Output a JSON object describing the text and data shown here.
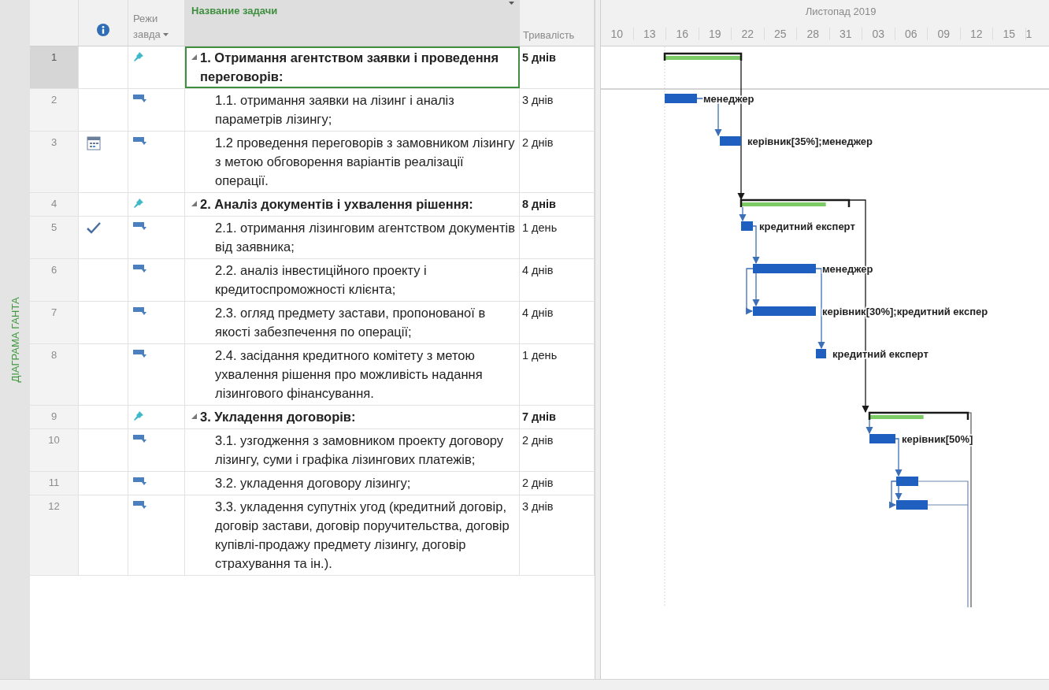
{
  "view_bar": {
    "label": "ДІАГРАМА ГАНТА"
  },
  "table": {
    "columns": {
      "mode": [
        "Режи",
        "завда"
      ],
      "name": "Название задачи",
      "duration": "Тривалість"
    },
    "rows": [
      {
        "id": "1",
        "kind": "summary",
        "calendar": false,
        "complete": false,
        "expanded": true,
        "selected": true,
        "name": "1. Отримання агентством заявки і проведення переговорів:",
        "duration": "5 днів",
        "level": 1
      },
      {
        "id": "2",
        "kind": "task",
        "calendar": false,
        "complete": false,
        "selected": false,
        "name": "1.1. отримання заявки на лізинг і аналіз параметрів лізингу;",
        "duration": "3 днів",
        "resources": "менеджер"
      },
      {
        "id": "3",
        "kind": "task",
        "calendar": true,
        "complete": false,
        "selected": false,
        "name": "1.2 проведення переговорів з замовником лізингу з метою обговорення варіантів реалізації операції.",
        "duration": "2 днів",
        "resources": "керівник[35%];менеджер"
      },
      {
        "id": "4",
        "kind": "summary",
        "calendar": false,
        "complete": false,
        "expanded": true,
        "selected": false,
        "name": "2. Аналіз документів і ухвалення рішення:",
        "duration": "8 днів",
        "level": 0.79
      },
      {
        "id": "5",
        "kind": "task",
        "calendar": false,
        "complete": true,
        "selected": false,
        "name": "2.1. отримання лізинговим агентством документів від заявника;",
        "duration": "1 день",
        "resources": "кредитний експерт"
      },
      {
        "id": "6",
        "kind": "task",
        "calendar": false,
        "complete": false,
        "selected": false,
        "name": "2.2. аналіз інвестиційного проекту і кредитоспроможності клієнта;",
        "duration": "4 днів",
        "resources": "менеджер"
      },
      {
        "id": "7",
        "kind": "task",
        "calendar": false,
        "complete": false,
        "selected": false,
        "name": "2.3. огляд предмету застави, пропонованої в якості забезпечення по операції;",
        "duration": "4 днів",
        "resources": "керівник[30%];кредитний експер"
      },
      {
        "id": "8",
        "kind": "task",
        "calendar": false,
        "complete": false,
        "selected": false,
        "name": "2.4. засідання кредитного комітету з метою ухвалення рішення про можливість надання лізингового фінансування.",
        "duration": "1 день",
        "resources": "кредитний експерт"
      },
      {
        "id": "9",
        "kind": "summary",
        "calendar": false,
        "complete": false,
        "expanded": true,
        "selected": false,
        "name": "3. Укладення договорів:",
        "duration": "7 днів",
        "level": 0.55
      },
      {
        "id": "10",
        "kind": "task",
        "calendar": false,
        "complete": false,
        "selected": false,
        "name": "3.1. узгодження з замовником проекту договору лізингу, суми і графіка лізингових платежів;",
        "duration": "2 днів",
        "resources": "керівник[50%]"
      },
      {
        "id": "11",
        "kind": "task",
        "calendar": false,
        "complete": false,
        "selected": false,
        "name": "3.2. укладення договору лізингу;",
        "duration": "2 днів"
      },
      {
        "id": "12",
        "kind": "task",
        "calendar": false,
        "complete": false,
        "selected": false,
        "name": "3.3. укладення супутніх угод (кредитний договір, договір застави, договір поручительства, договір купівлі-продажу предмету лізингу, договір страхування та ін.).",
        "duration": "3 днів"
      }
    ]
  },
  "timescale": {
    "month": "Листопад 2019",
    "days": [
      "10",
      "13",
      "16",
      "19",
      "22",
      "25",
      "28",
      "31",
      "03",
      "06",
      "09",
      "12",
      "15",
      "1"
    ]
  }
}
